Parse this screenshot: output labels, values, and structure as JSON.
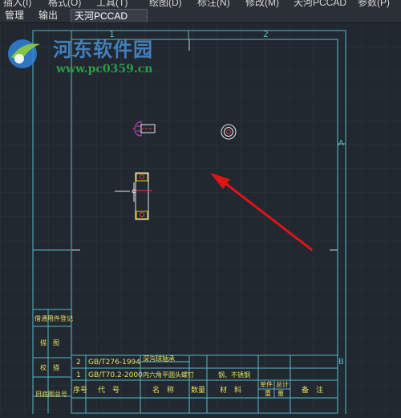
{
  "menubar": {
    "items": [
      "插入(I)",
      "格式(O)",
      "工具(T)",
      "绘图(D)",
      "标注(N)",
      "修改(M)",
      "天河PCCAD",
      "参数(P)"
    ]
  },
  "ribbon_tabs": {
    "items": [
      "管理",
      "输出",
      "天河PCCAD"
    ],
    "active": "天河PCCAD"
  },
  "watermark": {
    "site_name": "河东软件园",
    "url": "www.pc0359.cn"
  },
  "drawing": {
    "zone_top": [
      "1",
      "2"
    ],
    "zone_right": [
      "A",
      "B"
    ],
    "bom_rows": [
      {
        "seq": "2",
        "code": "GB/T276-1994",
        "name": "深沟球轴承",
        "qty": "",
        "material": "",
        "remark": ""
      },
      {
        "seq": "1",
        "code": "GB/T70.2-2000",
        "name": "内六角平圆头螺钉",
        "qty": "",
        "material": "钢、不锈钢",
        "remark": ""
      }
    ],
    "bom_header": {
      "seq": "序号",
      "code": "代　号",
      "name": "名　称",
      "qty": "数量",
      "material": "材　料",
      "unit_weight": "单件",
      "total_weight": "总计",
      "weight": "重　量",
      "remark": "备　注"
    },
    "side_labels": [
      "借通用件登记",
      "描　图",
      "校　描",
      "旧底图总号"
    ]
  },
  "colors": {
    "canvas": "#212830",
    "frame": "#58b8c8",
    "grid": "#2c3440",
    "text_yellow": "#e8e060",
    "arrow": "#dd1515",
    "part_white": "#e6e6e6",
    "part_magenta": "#d040d0"
  }
}
